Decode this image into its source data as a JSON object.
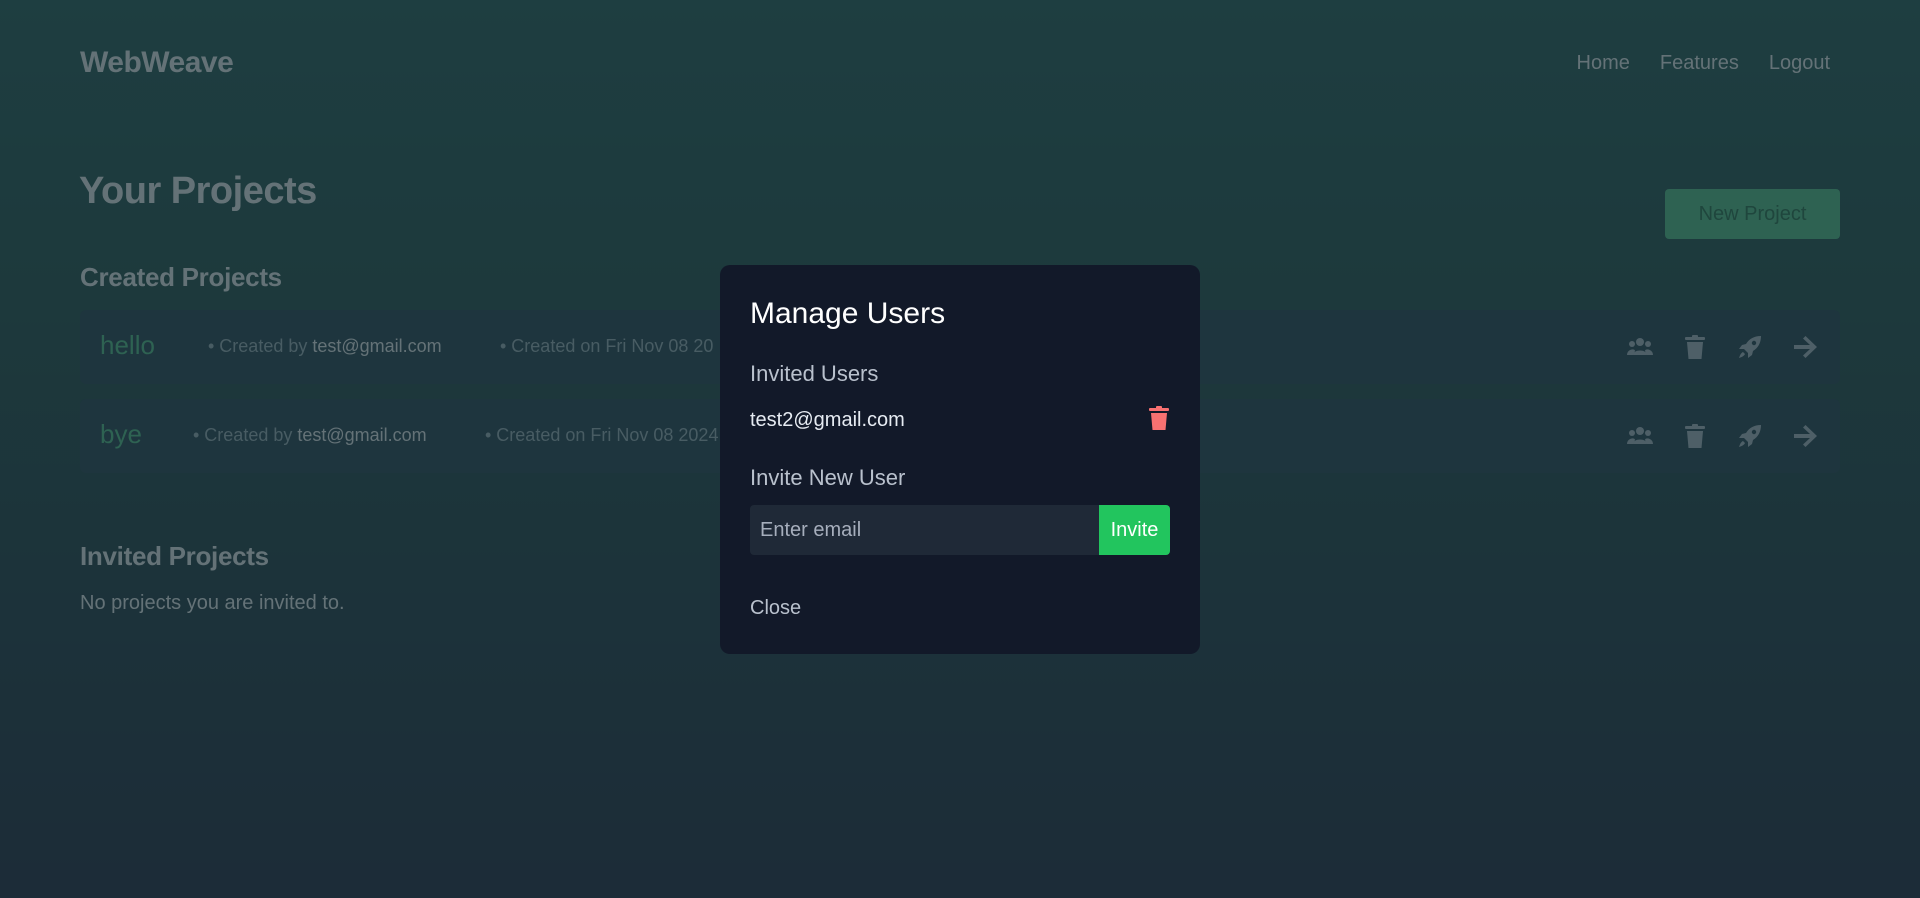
{
  "app": {
    "brand": "WebWeave"
  },
  "nav": {
    "items": [
      "Home",
      "Features",
      "Logout"
    ]
  },
  "projects": {
    "title": "Your Projects",
    "new_button": "New Project",
    "created_heading": "Created Projects",
    "created_prefix": "• Created by",
    "created_on_prefix": "• Created on",
    "created": [
      {
        "name": "hello",
        "owner": "test@gmail.com",
        "date": "Fri Nov 08 20"
      },
      {
        "name": "bye",
        "owner": "test@gmail.com",
        "date": "Fri Nov 08 2024"
      }
    ],
    "actions": [
      "users-icon",
      "trash-icon",
      "rocket-icon",
      "arrow-right-icon"
    ],
    "invited_heading": "Invited Projects",
    "invited_empty": "No projects you are invited to."
  },
  "modal": {
    "title": "Manage Users",
    "invited_label": "Invited Users",
    "invited_users": [
      "test2@gmail.com"
    ],
    "invite_label": "Invite New User",
    "email_placeholder": "Enter email",
    "email_value": "",
    "invite_button": "Invite",
    "close_button": "Close"
  },
  "colors": {
    "accent": "#22c55e",
    "project_name": "#4aa67c",
    "danger": "#f87171",
    "modal_bg": "#121929"
  }
}
